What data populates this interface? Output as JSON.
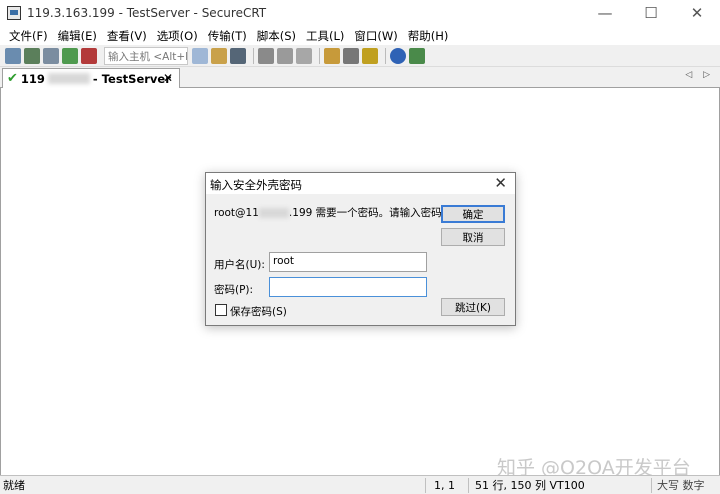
{
  "window": {
    "title": "119.3.163.199 - TestServer - SecureCRT",
    "minimize": "—",
    "maximize": "☐",
    "close": "✕"
  },
  "menu": [
    "文件(F)",
    "编辑(E)",
    "查看(V)",
    "选项(O)",
    "传输(T)",
    "脚本(S)",
    "工具(L)",
    "窗口(W)",
    "帮助(H)"
  ],
  "toolbar": {
    "quick_connect_placeholder": "输入主机 <Alt+R>"
  },
  "tab": {
    "label_prefix": "119",
    "label_suffix": "- TestServer",
    "close": "✕",
    "nav": "◁ ▷"
  },
  "dialog": {
    "title": "输入安全外壳密码",
    "close": "✕",
    "prompt_prefix": "root@11",
    "prompt_suffix": ".199 需要一个密码。请输入密码。",
    "username_label": "用户名(U):",
    "username_value": "root",
    "password_label": "密码(P):",
    "password_value": "",
    "save_password_label": "保存密码(S)",
    "save_password_checked": false,
    "ok_button": "确定",
    "cancel_button": "取消",
    "skip_button": "跳过(K)"
  },
  "watermark": "知乎 @O2OA开发平台",
  "statusbar": {
    "ready": "就绪",
    "position": "1,   1",
    "size": "51 行, 150 列 VT100",
    "caps": "大写 数字"
  },
  "colors": {
    "accent": "#3a7bd5",
    "tab_check": "#2e9d2e"
  }
}
